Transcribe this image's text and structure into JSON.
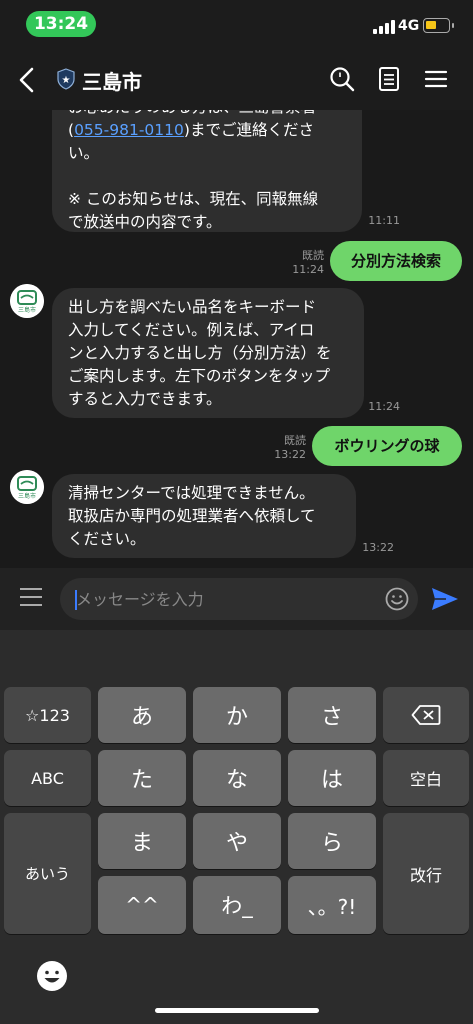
{
  "status": {
    "time": "13:24",
    "network": "4G"
  },
  "header": {
    "title": "三島市"
  },
  "messages": {
    "m1": {
      "line1": "お心あたりのある方は、三島警察署",
      "phone": "055-981-0110",
      "line2_rest": "までご連絡くださ",
      "line3": "い。",
      "line4": "※ このお知らせは、現在、同報無線",
      "line5": "で放送中の内容です。",
      "time": "11:11"
    },
    "m2": {
      "text": "分別方法検索",
      "read": "既読",
      "time": "11:24"
    },
    "m3": {
      "lines": [
        "出し方を調べたい品名をキーボード",
        "入力してください。例えば、アイロ",
        "ンと入力すると出し方（分別方法）を",
        "ご案内します。左下のボタンをタップ",
        "すると入力できます。"
      ],
      "time": "11:24"
    },
    "m4": {
      "text": "ボウリングの球",
      "read": "既読",
      "time": "13:22"
    },
    "m5": {
      "lines": [
        "清掃センターでは処理できません。",
        "取扱店か専門の処理業者へ依頼して",
        "ください。"
      ],
      "time": "13:22"
    }
  },
  "avatar_text": "三島市",
  "input": {
    "placeholder": "メッセージを入力"
  },
  "keyboard": {
    "k_sym": "☆123",
    "k_a": "あ",
    "k_ka": "か",
    "k_sa": "さ",
    "k_abc": "ABC",
    "k_ta": "た",
    "k_na": "な",
    "k_ha": "は",
    "k_space": "空白",
    "k_aiu": "あいう",
    "k_ma": "ま",
    "k_ya": "や",
    "k_ra": "ら",
    "k_enter": "改行",
    "k_dakuten": "^^",
    "k_wa": "わ_",
    "k_punct": "、。?!"
  },
  "colors": {
    "accent_green": "#6fd56a",
    "status_green": "#33c759",
    "link": "#5aa0ff",
    "send": "#3b7cff"
  }
}
